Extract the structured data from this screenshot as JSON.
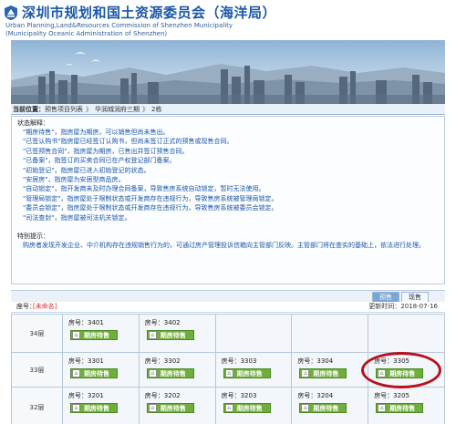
{
  "header": {
    "title_cn": "深圳市规划和国土资源委员会（海洋局）",
    "title_en1": "Urban Planning,Land&Resources Commission of Shenzhen Municipality",
    "title_en2": "(Municipality Oceanic Administration of Shenzhen)"
  },
  "breadcrumb": {
    "label": "当前位置：",
    "items": [
      "预售项目列表",
      "华润城润府三期",
      "2栋"
    ],
    "separator": "》"
  },
  "status_legend": {
    "heading": "状态解释：",
    "lines": [
      "\"期房待售\"，指房屋为期房，可以销售但尚未售出。",
      "\"已签认购书\"指房屋已经签订认购书，但尚未签订正式的预售或现售合同。",
      "\"已签预售合同\"，指房屋为期房，已售出并签订预售合同。",
      "\"已备案\"，指签订的买卖合同已在产权登记部门备案。",
      "\"初始登记\"，指房屋已进入初始登记的状态。",
      "\"安居房\"，指房屋为安居型商品房。",
      "\"自动锁定\"，指开发商未及时办理合同备案，导致售房系统自动锁定，暂时无法使用。",
      "\"管理局锁定\"，指房屋处于限制状态或开发商存在违规行为，导致售房系统被管理局锁定。",
      "\"委员会锁定\"，指房屋处于限制状态或开发商存在违规行为，导致售房系统被委员会锁定。",
      "\"司法查封\"，指房屋被司法机关锁定。"
    ],
    "tips_heading": "特别提示：",
    "tips_text": "购房者发现开发企业、中介机构存在违规销售行为的，可通过房产管理投诉信箱向主管部门反映。主管部门将在查实的基础上，依法进行处理。"
  },
  "tabs": {
    "presale": "预售",
    "current": "现售"
  },
  "building": {
    "label": "座号：",
    "name": "[未命名]",
    "updated_label": "更新时间：",
    "updated": "2018-07-16"
  },
  "floors": [
    {
      "name": "34层",
      "units": [
        {
          "room": "房号：3401",
          "status": "期房待售"
        },
        {
          "room": "房号：3402",
          "status": "期房待售"
        }
      ]
    },
    {
      "name": "33层",
      "units": [
        {
          "room": "房号：3301",
          "status": "期房待售"
        },
        {
          "room": "房号：3302",
          "status": "期房待售"
        },
        {
          "room": "房号：3303",
          "status": "期房待售"
        },
        {
          "room": "房号：3304",
          "status": "期房待售"
        },
        {
          "room": "房号：3305",
          "status": "期房待售"
        }
      ]
    },
    {
      "name": "32层",
      "units": [
        {
          "room": "房号：3201",
          "status": "期房待售"
        },
        {
          "room": "房号：3202",
          "status": "期房待售"
        },
        {
          "room": "房号：3203",
          "status": "期房待售"
        },
        {
          "room": "房号：3204",
          "status": "期房待售"
        },
        {
          "room": "房号：3205",
          "status": "期房待售"
        }
      ]
    }
  ],
  "colors": {
    "title_blue": "#1b58a8",
    "legend_blue": "#1a57a8",
    "status_green": "#6fae3a",
    "building_red": "#d62b2b",
    "highlight_red": "#b8121b"
  },
  "icons": {
    "logo": "emblem-icon",
    "unit_status": "house-icon"
  }
}
